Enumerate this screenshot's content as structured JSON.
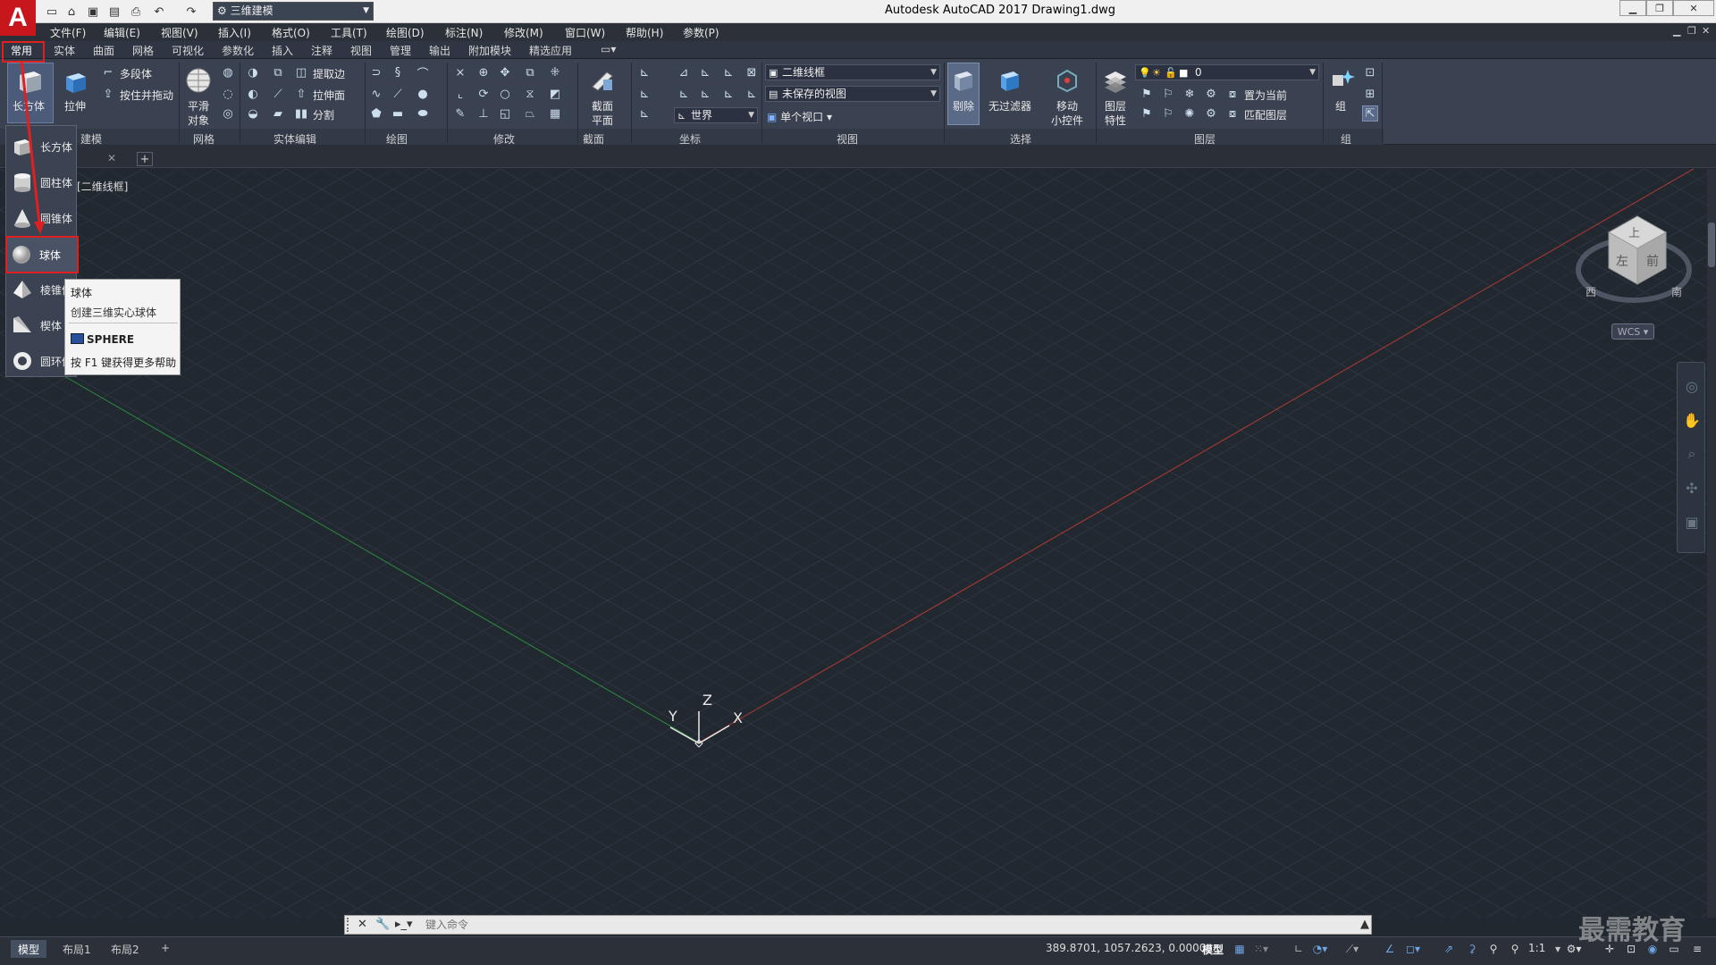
{
  "titlebar": {
    "title": "Autodesk AutoCAD 2017    Drawing1.dwg",
    "logo": "A",
    "workspace": "三维建模",
    "qat_icons": [
      "new-icon",
      "open-icon",
      "save-icon",
      "saveas-icon",
      "print-icon",
      "undo-icon",
      "redo-icon"
    ]
  },
  "menu": [
    "文件(F)",
    "编辑(E)",
    "视图(V)",
    "插入(I)",
    "格式(O)",
    "工具(T)",
    "绘图(D)",
    "标注(N)",
    "修改(M)",
    "窗口(W)",
    "帮助(H)",
    "参数(P)"
  ],
  "ribbon_tabs": [
    "常用",
    "实体",
    "曲面",
    "网格",
    "可视化",
    "参数化",
    "插入",
    "注释",
    "视图",
    "管理",
    "输出",
    "附加模块",
    "精选应用"
  ],
  "ribbon": {
    "modeling": {
      "box": "长方体",
      "extrude": "拉伸",
      "polysolid": "多段体",
      "presspull": "按住并拖动",
      "title": "建模"
    },
    "mesh": {
      "smooth": "平滑",
      "smooth2": "对象",
      "title": "网格"
    },
    "solid_edit": {
      "extract_edges": "提取边",
      "extrude_faces": "拉伸面",
      "separate": "分割",
      "title": "实体编辑"
    },
    "draw": {
      "title": "绘图"
    },
    "modify": {
      "title": "修改"
    },
    "section": {
      "plane": "截面",
      "plane2": "平面",
      "title": "截面"
    },
    "coordinates": {
      "world": "世界",
      "title": "坐标"
    },
    "view": {
      "visual_style": "二维线框",
      "saved_view": "未保存的视图",
      "single_viewport": "单个视口",
      "title": "视图"
    },
    "selection": {
      "cull": "剔除",
      "no_filter": "无过滤器",
      "gizmo": "移动",
      "gizmo2": "小控件",
      "title": "选择"
    },
    "layers": {
      "layer_props": "图层",
      "layer_props2": "特性",
      "current_layer": "0",
      "set_current": "置为当前",
      "match_layer": "匹配图层",
      "title": "图层"
    },
    "groups": {
      "group": "组",
      "title": "组"
    }
  },
  "viewport": {
    "label": "[二维线框]"
  },
  "dropdown": {
    "items": [
      {
        "label": "长方体",
        "icon": "box-icon"
      },
      {
        "label": "圆柱体",
        "icon": "cylinder-icon"
      },
      {
        "label": "圆锥体",
        "icon": "cone-icon"
      },
      {
        "label": "球体",
        "icon": "sphere-icon"
      },
      {
        "label": "棱锥体",
        "icon": "pyramid-icon"
      },
      {
        "label": "楔体",
        "icon": "wedge-icon"
      },
      {
        "label": "圆环体",
        "icon": "torus-icon"
      }
    ]
  },
  "tooltip": {
    "title": "球体",
    "desc": "创建三维实心球体",
    "command": "SPHERE",
    "help": "按 F1 键获得更多帮助"
  },
  "viewcube": {
    "top": "上",
    "front": "前",
    "left": "左",
    "west": "西",
    "south": "南",
    "wcs": "WCS"
  },
  "ucs": {
    "x": "X",
    "y": "Y",
    "z": "Z"
  },
  "command_line": {
    "placeholder": "键入命令"
  },
  "status": {
    "layout_tabs": [
      "模型",
      "布局1",
      "布局2"
    ],
    "coords": "389.8701, 1057.2623, 0.0000",
    "model": "模型",
    "scale": "1:1"
  },
  "watermark": "最需教育",
  "colors": {
    "accent_red": "#e02020",
    "x_axis": "#c0392b",
    "y_axis": "#2e8b3e",
    "viewport_bg": "#212830"
  }
}
